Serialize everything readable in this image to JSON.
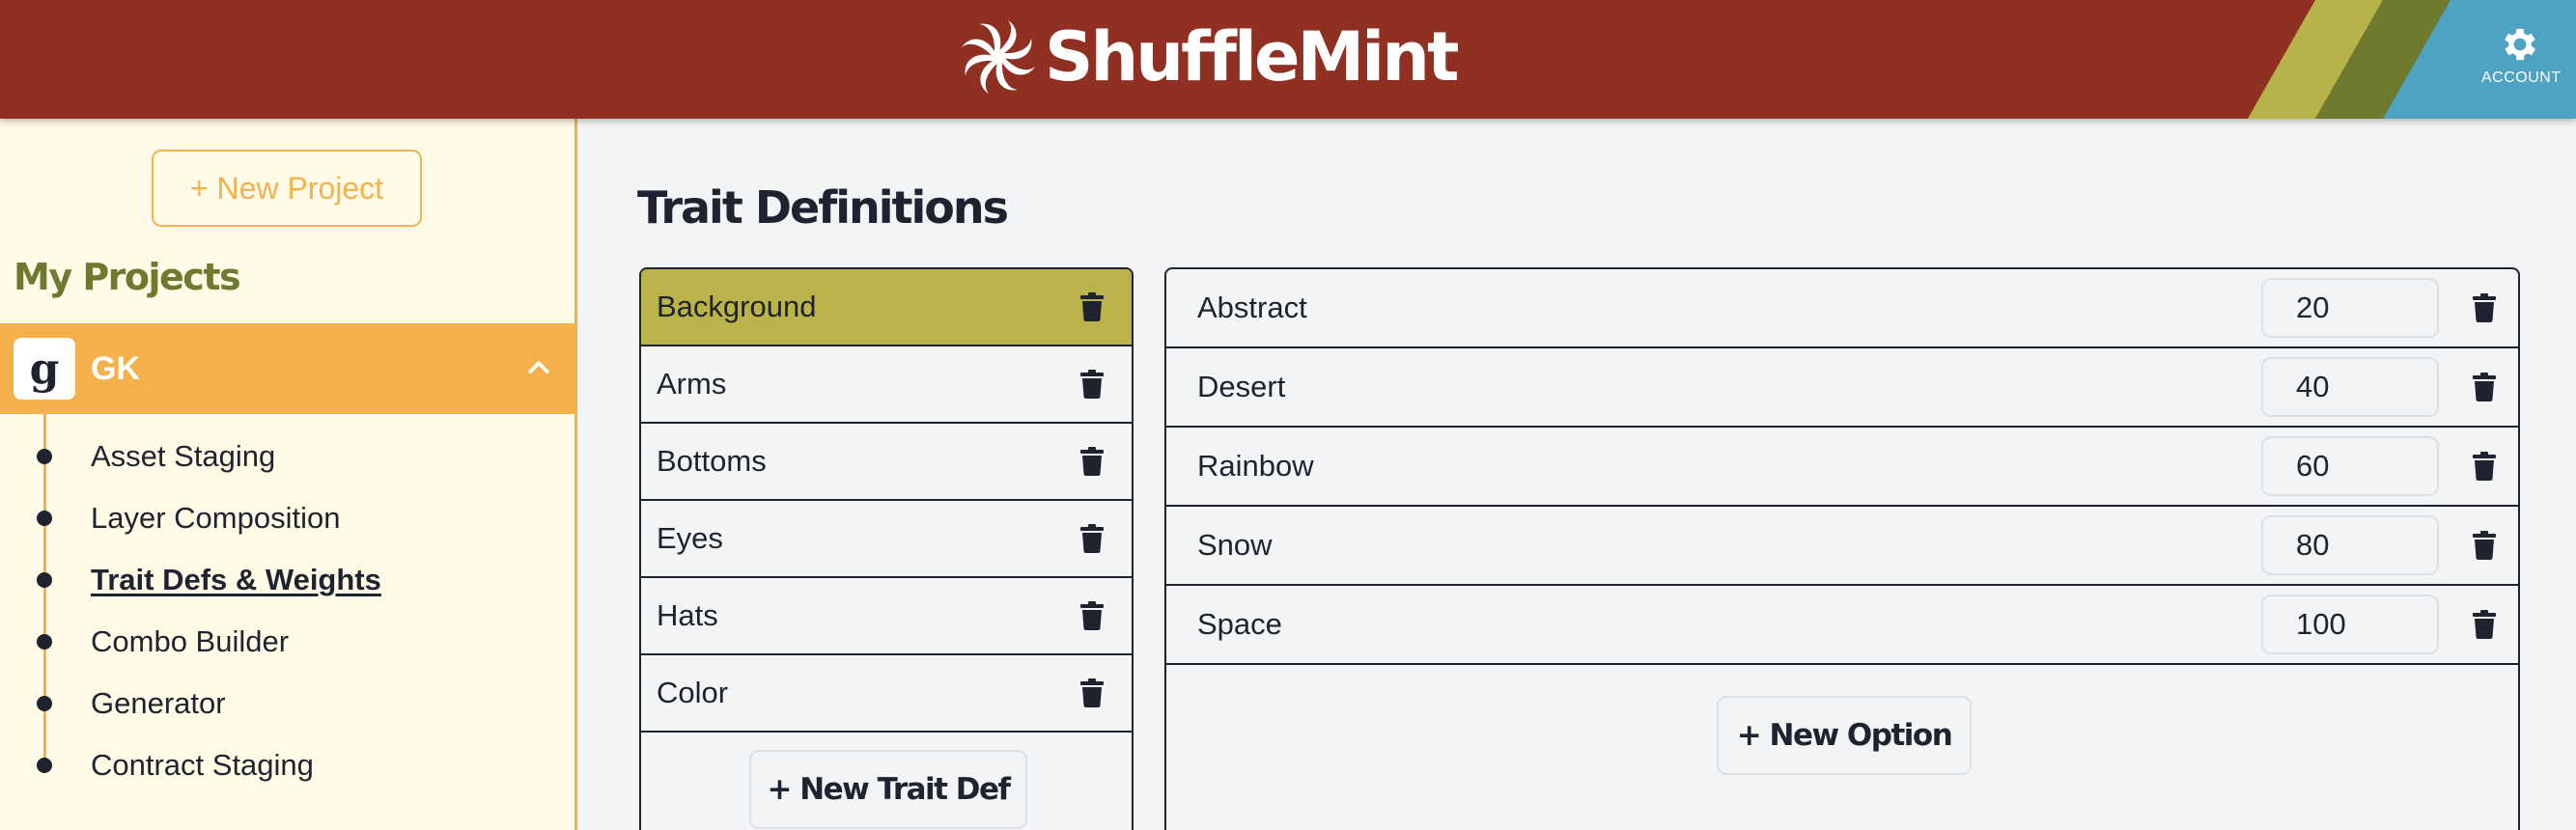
{
  "header": {
    "brand": "ShuffleMint",
    "account_label": "ACCOUNT",
    "colors": {
      "header_bg": "#8f3022",
      "stripe_olive": "#b5b34a",
      "stripe_green": "#6e7a2e",
      "stripe_blue": "#4fa3c2"
    }
  },
  "sidebar": {
    "new_project_label": "+ New Project",
    "section_title": "My Projects",
    "project": {
      "name": "GK",
      "avatar_glyph": "g"
    },
    "nav_items": [
      {
        "label": "Asset Staging",
        "active": false
      },
      {
        "label": "Layer Composition",
        "active": false
      },
      {
        "label": "Trait Defs & Weights",
        "active": true
      },
      {
        "label": "Combo Builder",
        "active": false
      },
      {
        "label": "Generator",
        "active": false
      },
      {
        "label": "Contract Staging",
        "active": false
      }
    ]
  },
  "main": {
    "title": "Trait Definitions",
    "trait_defs": [
      {
        "name": "Background",
        "selected": true
      },
      {
        "name": "Arms",
        "selected": false
      },
      {
        "name": "Bottoms",
        "selected": false
      },
      {
        "name": "Eyes",
        "selected": false
      },
      {
        "name": "Hats",
        "selected": false
      },
      {
        "name": "Color",
        "selected": false
      }
    ],
    "new_trait_label": "+ New Trait Def",
    "options": [
      {
        "name": "Abstract",
        "weight": "20"
      },
      {
        "name": "Desert",
        "weight": "40"
      },
      {
        "name": "Rainbow",
        "weight": "60"
      },
      {
        "name": "Snow",
        "weight": "80"
      },
      {
        "name": "Space",
        "weight": "100"
      }
    ],
    "new_option_label": "+ New Option"
  },
  "icons": {
    "logo": "swirl-logo-icon",
    "account": "gear-icon",
    "delete": "trash-icon",
    "collapse": "chevron-up-icon"
  }
}
